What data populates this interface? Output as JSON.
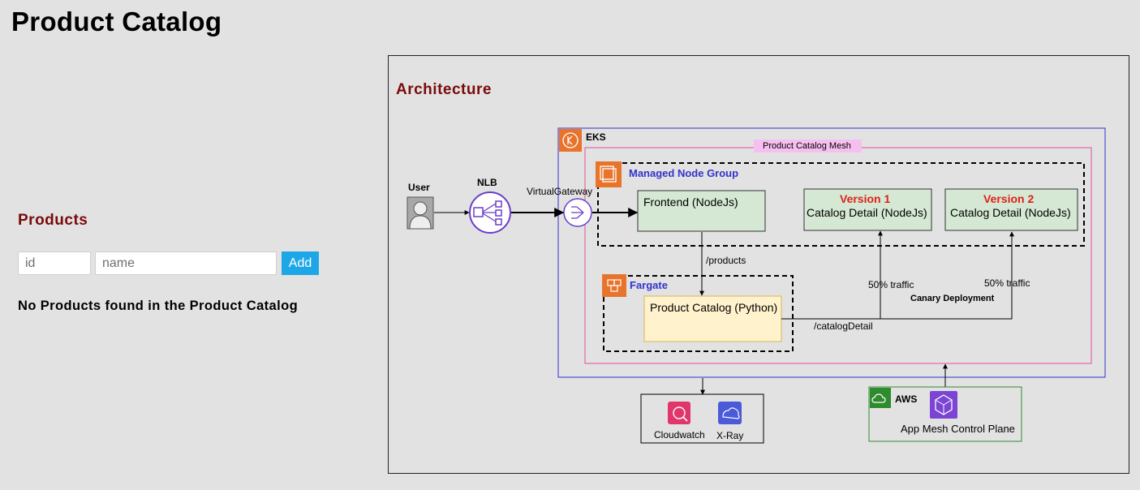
{
  "page": {
    "title": "Product Catalog"
  },
  "products": {
    "heading": "Products",
    "id_placeholder": "id",
    "name_placeholder": "name",
    "add_label": "Add",
    "empty_message": "No Products found in the Product Catalog"
  },
  "architecture": {
    "heading": "Architecture",
    "user_label": "User",
    "nlb_label": "NLB",
    "virtual_gateway_label": "VirtualGateway",
    "eks_label": "EKS",
    "mesh_label": "Product Catalog Mesh",
    "managed_node_group_label": "Managed Node Group",
    "frontend_label": "Frontend (NodeJs)",
    "version1": {
      "title": "Version 1",
      "label": "Catalog Detail (NodeJs)"
    },
    "version2": {
      "title": "Version 2",
      "label": "Catalog Detail (NodeJs)"
    },
    "products_path": "/products",
    "fargate_label": "Fargate",
    "product_catalog_label": "Product Catalog (Python)",
    "catalog_detail_path": "/catalogDetail",
    "traffic_v1": "50% traffic",
    "traffic_v2": "50% traffic",
    "canary_label": "Canary Deployment",
    "cloudwatch_label": "Cloudwatch",
    "xray_label": "X-Ray",
    "aws_label": "AWS",
    "control_plane_label": "App Mesh Control Plane",
    "colors": {
      "heading_red": "#7a0b0b",
      "version_red": "#e0201b",
      "eks_blue": "#3333cc",
      "mesh_pink": "#e0519a",
      "aws_orange": "#e8742c",
      "aws_green": "#2e8b2e",
      "add_button": "#1ea7e6",
      "service_green": "#d5e8d4",
      "service_yellow": "#fff2cc"
    }
  }
}
